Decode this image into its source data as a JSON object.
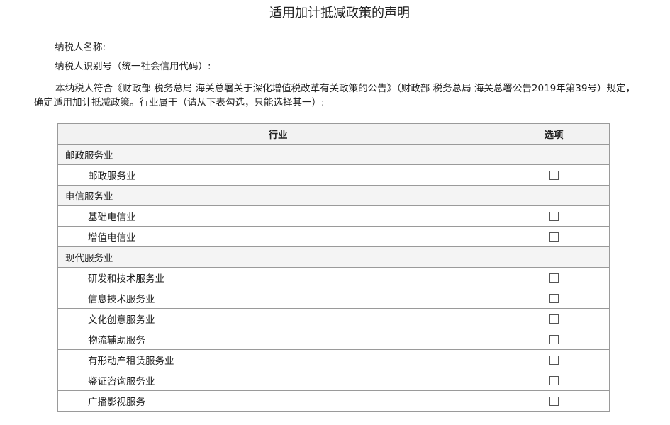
{
  "title": "适用加计抵减政策的声明",
  "taxpayer_name_label": "纳税人名称:",
  "taxpayer_id_label": "纳税人识别号（统一社会信用代码）:",
  "statement": "本纳税人符合《财政部 税务总局 海关总署关于深化增值税改革有关政策的公告》（财政部 税务总局 海关总署公告2019年第39号）规定，确定适用加计抵减政策。行业属于（请从下表勾选，只能选择其一）:",
  "table": {
    "col_industry": "行业",
    "col_option": "选项",
    "groups": [
      {
        "category": "邮政服务业",
        "items": [
          "邮政服务业"
        ]
      },
      {
        "category": "电信服务业",
        "items": [
          "基础电信业",
          "增值电信业"
        ]
      },
      {
        "category": "现代服务业",
        "items": [
          "研发和技术服务业",
          "信息技术服务业",
          "文化创意服务业",
          "物流辅助服务",
          "有形动产租赁服务业",
          "鉴证咨询服务业",
          "广播影视服务"
        ]
      }
    ]
  }
}
